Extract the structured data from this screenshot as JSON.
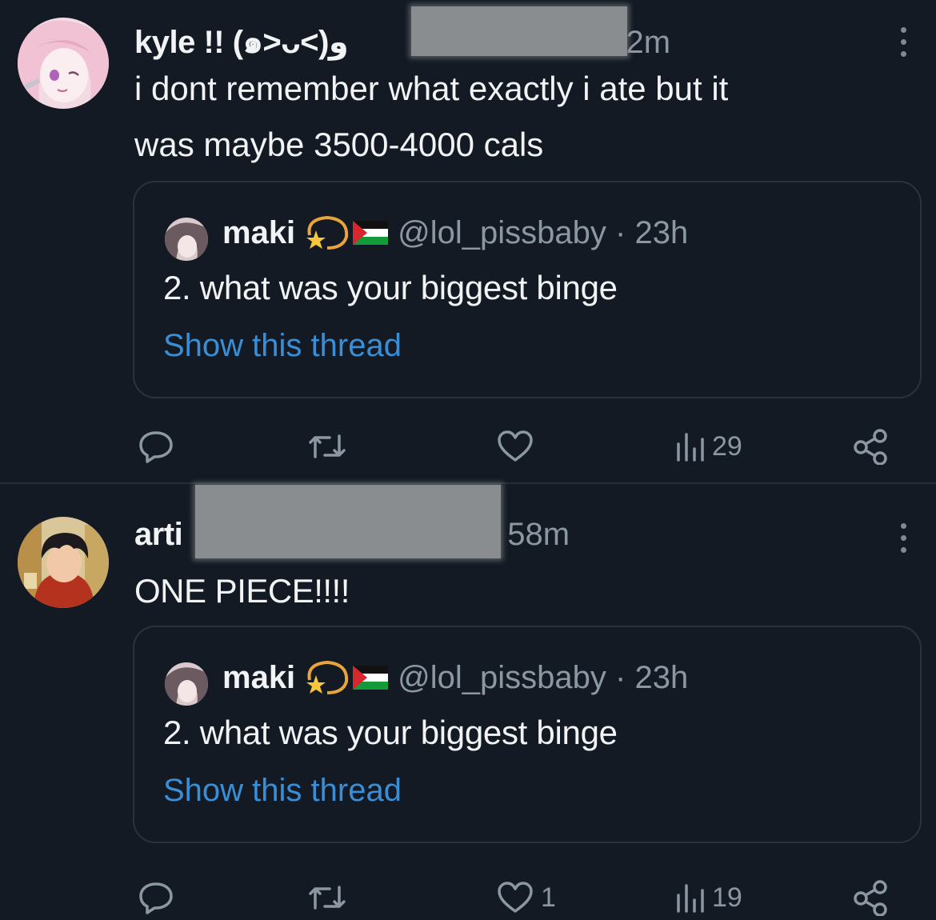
{
  "tweets": [
    {
      "author_name": "kyle !! (๑>ᴗ<)و",
      "time": "· 32m",
      "text_line1": "i dont remember what exactly i ate but it",
      "text_line2": "was maybe 3500-4000 cals",
      "avatar_icon": "anime-pink-hair-avatar",
      "quote": {
        "name": "maki",
        "handle_time": "@lol_pissbaby · 23h",
        "text": "2. what was your biggest binge",
        "link": "Show this thread",
        "emoji_icons": [
          "dizzy-star-emoji",
          "palestine-flag-emoji"
        ]
      },
      "actions": {
        "reply_count": "",
        "retweet_count": "",
        "like_count": "",
        "views_count": "29"
      }
    },
    {
      "author_name": "arti",
      "time": "58m",
      "text_line1": "ONE PIECE!!!!",
      "text_line2": "",
      "avatar_icon": "anime-dark-hair-avatar",
      "quote": {
        "name": "maki",
        "handle_time": "@lol_pissbaby · 23h",
        "text": "2. what was your biggest binge",
        "link": "Show this thread",
        "emoji_icons": [
          "dizzy-star-emoji",
          "palestine-flag-emoji"
        ]
      },
      "actions": {
        "reply_count": "",
        "retweet_count": "",
        "like_count": "1",
        "views_count": "19"
      }
    }
  ],
  "colors": {
    "background": "#141a23",
    "text_primary": "#f1f3f5",
    "text_secondary": "#8b97a2",
    "link": "#3a8ed6",
    "border": "#2a333d",
    "redaction": "#8a8d90"
  }
}
